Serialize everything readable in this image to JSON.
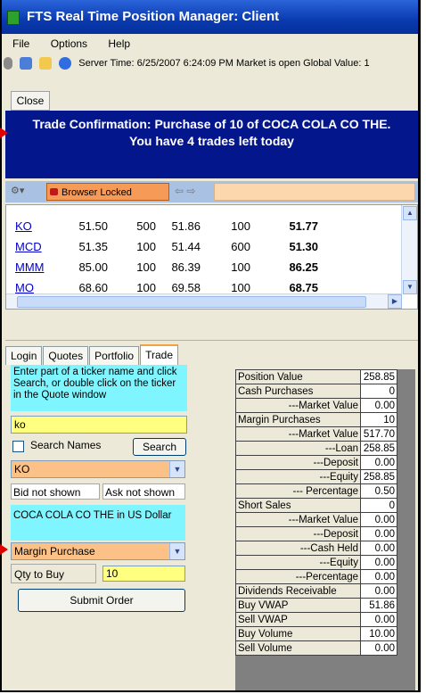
{
  "window": {
    "title": "FTS Real Time Position Manager: Client"
  },
  "menu": [
    "File",
    "Options",
    "Help"
  ],
  "toolbar": {
    "status": "Server Time: 6/25/2007 6:24:09 PM  Market is open  Global Value: 1"
  },
  "close_label": "Close",
  "banner": {
    "line1": "Trade Confirmation: Purchase of 10 of COCA COLA CO THE.",
    "line2": "You have 4 trades left today"
  },
  "browser": {
    "locked_label": "Browser Locked"
  },
  "quotes": [
    {
      "symbol": "KO",
      "bid": "51.50",
      "bid_size": "500",
      "ask": "51.86",
      "ask_size": "100",
      "last": "51.77"
    },
    {
      "symbol": "MCD",
      "bid": "51.35",
      "bid_size": "100",
      "ask": "51.44",
      "ask_size": "600",
      "last": "51.30"
    },
    {
      "symbol": "MMM",
      "bid": "85.00",
      "bid_size": "100",
      "ask": "86.39",
      "ask_size": "100",
      "last": "86.25"
    },
    {
      "symbol": "MO",
      "bid": "68.60",
      "bid_size": "100",
      "ask": "69.58",
      "ask_size": "100",
      "last": "68.75"
    }
  ],
  "tabs": [
    "Login",
    "Quotes",
    "Portfolio",
    "Trade"
  ],
  "trade": {
    "hint": "Enter part of a ticker name and click Search, or double click on the ticker in the Quote window",
    "ticker_value": "ko",
    "search_names_label": "Search Names",
    "search_button": "Search",
    "ticker_select": "KO",
    "bid_text": "Bid not shown",
    "ask_text": "Ask not shown",
    "description": "COCA COLA CO THE in US Dollar",
    "order_type": "Margin Purchase",
    "qty_label": "Qty to Buy",
    "qty_value": "10",
    "submit_label": "Submit Order"
  },
  "portfolio": [
    {
      "label": "Position Value",
      "value": "258.85",
      "indent": false
    },
    {
      "label": "Cash Purchases",
      "value": "0",
      "indent": false
    },
    {
      "label": "---Market Value",
      "value": "0.00",
      "indent": true
    },
    {
      "label": "Margin Purchases",
      "value": "10",
      "indent": false
    },
    {
      "label": "---Market Value",
      "value": "517.70",
      "indent": true
    },
    {
      "label": "---Loan",
      "value": "258.85",
      "indent": true
    },
    {
      "label": "---Deposit",
      "value": "0.00",
      "indent": true
    },
    {
      "label": "---Equity",
      "value": "258.85",
      "indent": true
    },
    {
      "label": "--- Percentage",
      "value": "0.50",
      "indent": true
    },
    {
      "label": "Short Sales",
      "value": "0",
      "indent": false
    },
    {
      "label": "---Market Value",
      "value": "0.00",
      "indent": true
    },
    {
      "label": "---Deposit",
      "value": "0.00",
      "indent": true
    },
    {
      "label": "---Cash Held",
      "value": "0.00",
      "indent": true
    },
    {
      "label": "---Equity",
      "value": "0.00",
      "indent": true
    },
    {
      "label": "---Percentage",
      "value": "0.00",
      "indent": true
    },
    {
      "label": "Dividends Receivable",
      "value": "0.00",
      "indent": false
    },
    {
      "label": "Buy VWAP",
      "value": "51.86",
      "indent": false
    },
    {
      "label": "Sell VWAP",
      "value": "0.00",
      "indent": false
    },
    {
      "label": "Buy Volume",
      "value": "10.00",
      "indent": false
    },
    {
      "label": "Sell Volume",
      "value": "0.00",
      "indent": false
    }
  ]
}
